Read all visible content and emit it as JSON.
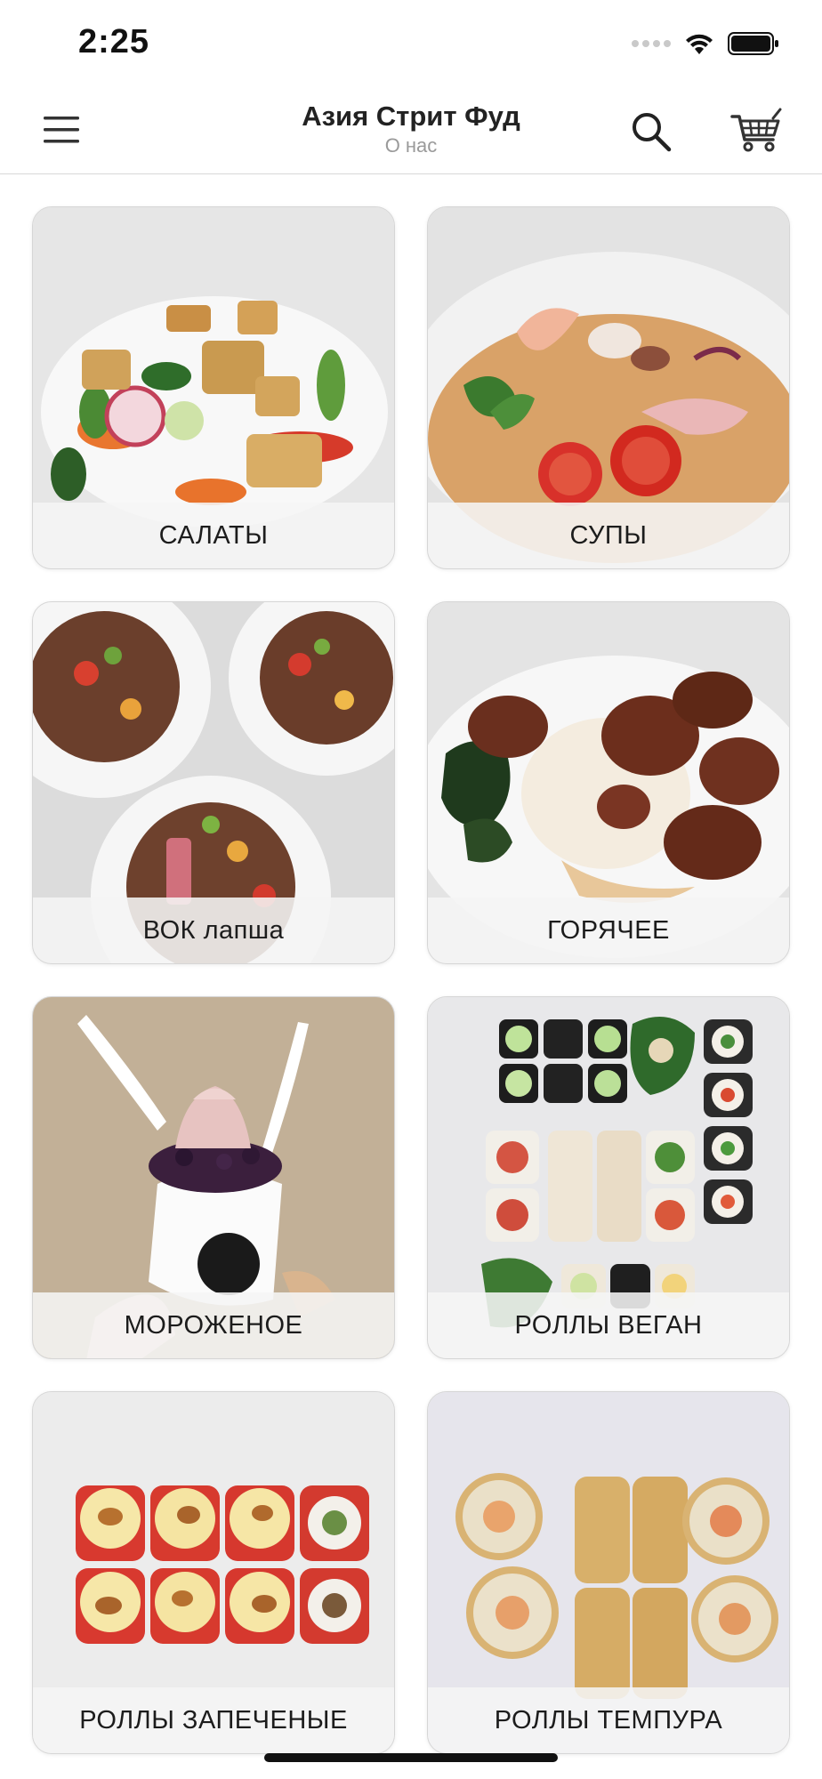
{
  "status_bar": {
    "time": "2:25",
    "icons": [
      "signal-icon",
      "wifi-icon",
      "battery-icon"
    ]
  },
  "header": {
    "title": "Азия Стрит Фуд",
    "subtitle": "О нас",
    "icons": [
      "menu-icon",
      "search-icon",
      "cart-icon"
    ]
  },
  "categories": [
    {
      "label": "САЛАТЫ"
    },
    {
      "label": "СУПЫ"
    },
    {
      "label": "ВОК лапша"
    },
    {
      "label": "ГОРЯЧЕЕ"
    },
    {
      "label": "МОРОЖЕНОЕ"
    },
    {
      "label": "РОЛЛЫ ВЕГАН"
    },
    {
      "label": "РОЛЛЫ ЗАПЕЧЕНЫЕ"
    },
    {
      "label": "РОЛЛЫ ТЕМПУРА"
    }
  ],
  "colors": {
    "separator": "#d8d8d8",
    "subtitle": "#9a9a9a",
    "label_background": "#f5f5f5"
  }
}
